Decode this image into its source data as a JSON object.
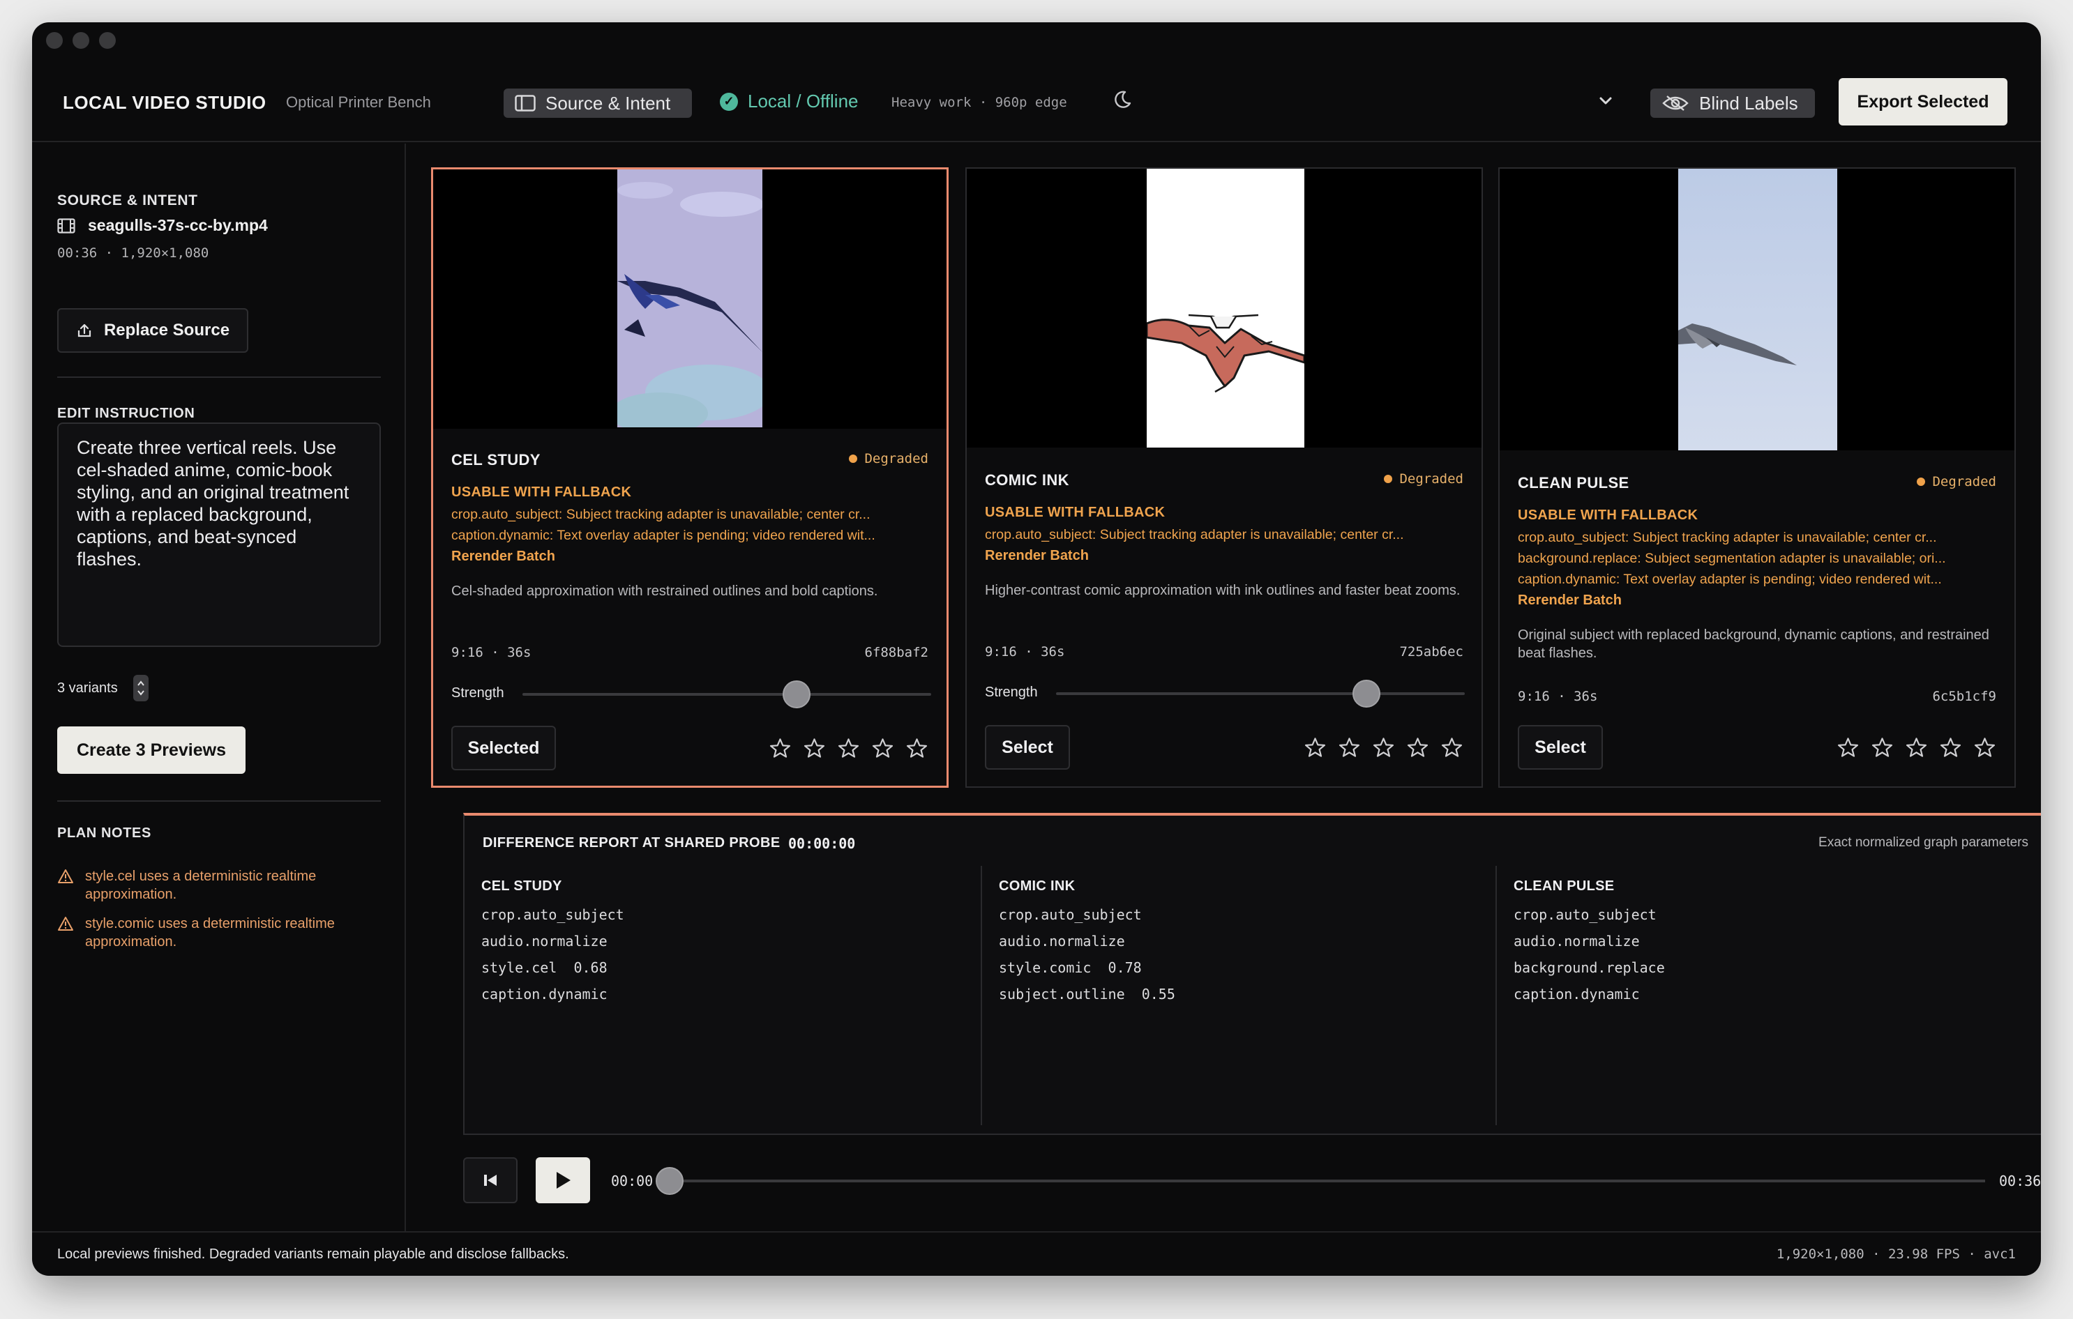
{
  "window": {
    "app_title": "LOCAL VIDEO STUDIO",
    "app_subtitle": "Optical Printer Bench"
  },
  "topbar": {
    "source_toggle": {
      "label": "Source & Intent",
      "icon": "sidebar-icon"
    },
    "local_status": {
      "label": "Local / Offline",
      "icon": "check-circle-icon",
      "color": "#63c9b0"
    },
    "heavy_work": "Heavy work · 960p edge",
    "theme_icon": "moon-icon",
    "menu_icon": "chevron-down-icon",
    "blind_labels": {
      "label": "Blind Labels",
      "icon": "eye-off-icon"
    },
    "export_label": "Export Selected"
  },
  "sidebar": {
    "source_header": "SOURCE & INTENT",
    "file_name": "seagulls-37s-cc-by.mp4",
    "file_meta": "00:36  ·  1,920×1,080",
    "replace_label": "Replace Source",
    "instruction_header": "EDIT INSTRUCTION",
    "instruction_text": "Create three vertical reels. Use cel-shaded anime, comic-book styling, and an original treatment with a replaced background, captions, and beat-synced flashes.",
    "variants_label": "3 variants",
    "create_label": "Create 3 Previews",
    "plan_header": "PLAN NOTES",
    "notes": [
      "style.cel uses a deterministic realtime approximation.",
      "style.comic uses a deterministic realtime approximation."
    ]
  },
  "variants": [
    {
      "title": "CEL STUDY",
      "badge": "Degraded",
      "fallback_title": "USABLE WITH FALLBACK",
      "fallback_lines": [
        "crop.auto_subject: Subject tracking adapter is unavailable; center cr...",
        "caption.dynamic: Text overlay adapter is pending; video rendered wit..."
      ],
      "rerender": "Rerender Batch",
      "description": "Cel-shaded approximation with restrained outlines and bold captions.",
      "format": "9:16 · 36s",
      "hash": "6f88baf2",
      "strength_label": "Strength",
      "strength": 0.67,
      "button_label": "Selected",
      "rating": 0
    },
    {
      "title": "COMIC INK",
      "badge": "Degraded",
      "fallback_title": "USABLE WITH FALLBACK",
      "fallback_lines": [
        "crop.auto_subject: Subject tracking adapter is unavailable; center cr..."
      ],
      "rerender": "Rerender Batch",
      "description": "Higher-contrast comic approximation with ink outlines and faster beat zooms.",
      "format": "9:16 · 36s",
      "hash": "725ab6ec",
      "strength_label": "Strength",
      "strength": 0.76,
      "button_label": "Select",
      "rating": 0
    },
    {
      "title": "CLEAN PULSE",
      "badge": "Degraded",
      "fallback_title": "USABLE WITH FALLBACK",
      "fallback_lines": [
        "crop.auto_subject: Subject tracking adapter is unavailable; center cr...",
        "background.replace: Subject segmentation adapter is unavailable; ori...",
        "caption.dynamic: Text overlay adapter is pending; video rendered wit..."
      ],
      "rerender": "Rerender Batch",
      "description": "Original subject with replaced background, dynamic captions, and restrained beat flashes.",
      "format": "9:16 · 36s",
      "hash": "6c5b1cf9",
      "button_label": "Select",
      "rating": 0
    }
  ],
  "report": {
    "title": "DIFFERENCE REPORT AT SHARED PROBE",
    "probe_time": "00:00:00",
    "right_label": "Exact normalized graph parameters",
    "columns": [
      {
        "name": "CEL STUDY",
        "params": [
          "crop.auto_subject",
          "audio.normalize",
          "style.cel  0.68",
          "caption.dynamic"
        ]
      },
      {
        "name": "COMIC INK",
        "params": [
          "crop.auto_subject",
          "audio.normalize",
          "style.comic  0.78",
          "subject.outline  0.55"
        ]
      },
      {
        "name": "CLEAN PULSE",
        "params": [
          "crop.auto_subject",
          "audio.normalize",
          "background.replace",
          "caption.dynamic"
        ]
      }
    ]
  },
  "transport": {
    "current_time": "00:00",
    "duration": "00:36",
    "position": 0
  },
  "status": {
    "message": "Local previews finished. Degraded variants remain playable and disclose fallbacks.",
    "specs": "1,920×1,080 · 23.98 FPS · avc1"
  },
  "colors": {
    "accent": "#e98a6e",
    "warning": "#f0a44e",
    "success": "#63c9b0"
  }
}
